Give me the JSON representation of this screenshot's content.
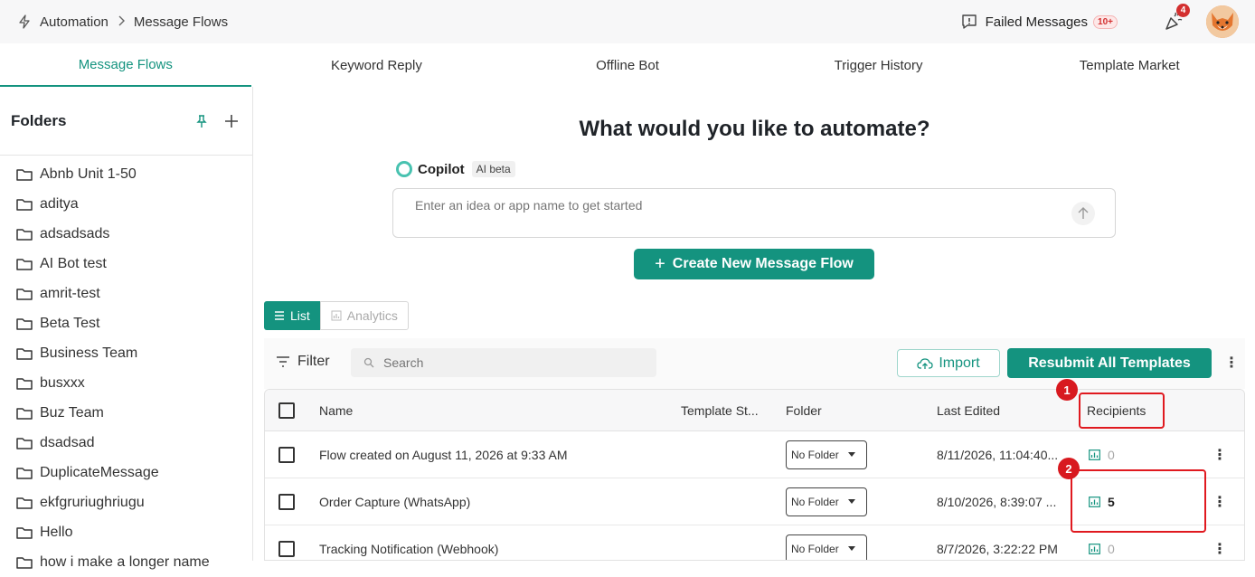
{
  "breadcrumb": {
    "root": "Automation",
    "current": "Message Flows"
  },
  "topbar": {
    "failed_label": "Failed Messages",
    "failed_count": "10+",
    "notif_count": "4"
  },
  "tabs": [
    "Message Flows",
    "Keyword Reply",
    "Offline Bot",
    "Trigger History",
    "Template Market"
  ],
  "sidebar": {
    "title": "Folders",
    "folders": [
      "Abnb Unit 1-50",
      "aditya",
      "adsadsads",
      "AI Bot test",
      "amrit-test",
      "Beta Test",
      "Business Team",
      "busxxx",
      "Buz Team",
      "dsadsad",
      "DuplicateMessage",
      "ekfgruriughriugu",
      "Hello",
      "how i make a longer name"
    ]
  },
  "main": {
    "heading": "What would you like to automate?",
    "copilot_name": "Copilot",
    "copilot_tag": "AI beta",
    "prompt_placeholder": "Enter an idea or app name to get started",
    "create_label": "Create New Message Flow",
    "view_list": "List",
    "view_analytics": "Analytics",
    "filter_label": "Filter",
    "search_placeholder": "Search",
    "import_label": "Import",
    "resubmit_label": "Resubmit All Templates"
  },
  "table": {
    "columns": [
      "Name",
      "Template St...",
      "Folder",
      "Last Edited",
      "Recipients"
    ],
    "rows": [
      {
        "name": "Flow created on August 11, 2026 at 9:33 AM",
        "folder": "No Folder",
        "edited": "8/11/2026, 11:04:40...",
        "recipients": "0"
      },
      {
        "name": "Order Capture (WhatsApp)",
        "folder": "No Folder",
        "edited": "8/10/2026, 8:39:07 ...",
        "recipients": "5"
      },
      {
        "name": "Tracking Notification (Webhook)",
        "folder": "No Folder",
        "edited": "8/7/2026, 3:22:22 PM",
        "recipients": "0"
      }
    ]
  },
  "annotations": [
    "1",
    "2"
  ],
  "colors": {
    "accent": "#14937f",
    "annotation": "#e0191f"
  }
}
